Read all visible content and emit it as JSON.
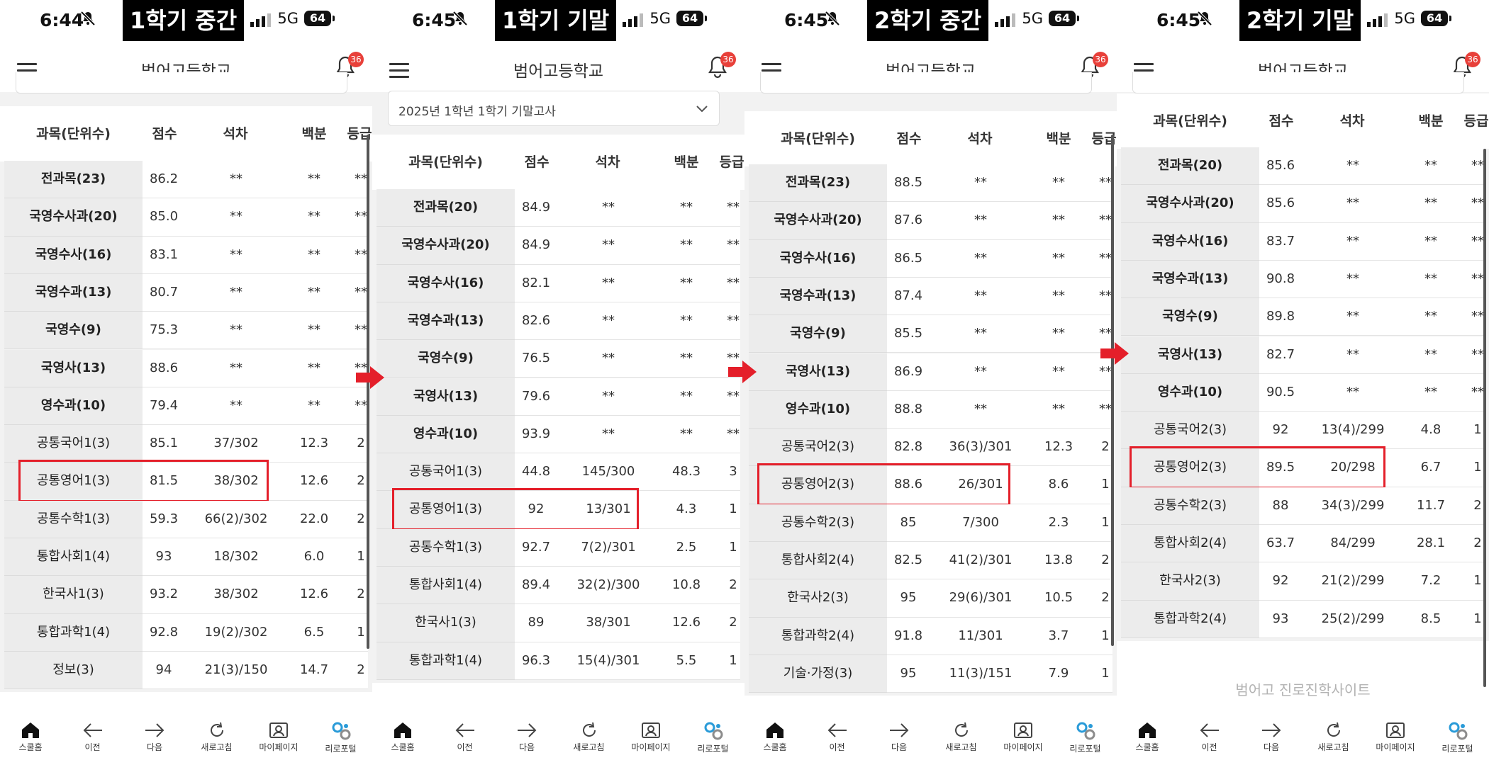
{
  "nav_labels": {
    "home": "스쿨홈",
    "prev": "이전",
    "next": "다음",
    "refresh": "새로고침",
    "mypage": "마이페이지",
    "portal": "리로포털"
  },
  "header_columns": {
    "subject": "과목(단위수)",
    "score": "점수",
    "rank": "석차",
    "percent": "백분",
    "grade": "등급"
  },
  "colors": {
    "highlight": "#e41f2a",
    "badge": "#e8403a",
    "label_bg": "#000000"
  },
  "panels": [
    {
      "time": "6:44",
      "network": "5G",
      "battery": "64",
      "label": "1학기 중간",
      "school": "범어고등학교",
      "badge": "36",
      "dropdown": null,
      "rows": [
        {
          "subject": "전과목(23)",
          "bold": true,
          "score": "86.2",
          "rank": "**",
          "percent": "**",
          "grade": "**"
        },
        {
          "subject": "국영수사과(20)",
          "bold": true,
          "score": "85.0",
          "rank": "**",
          "percent": "**",
          "grade": "**"
        },
        {
          "subject": "국영수사(16)",
          "bold": true,
          "score": "83.1",
          "rank": "**",
          "percent": "**",
          "grade": "**"
        },
        {
          "subject": "국영수과(13)",
          "bold": true,
          "score": "80.7",
          "rank": "**",
          "percent": "**",
          "grade": "**"
        },
        {
          "subject": "국영수(9)",
          "bold": true,
          "score": "75.3",
          "rank": "**",
          "percent": "**",
          "grade": "**"
        },
        {
          "subject": "국영사(13)",
          "bold": true,
          "score": "88.6",
          "rank": "**",
          "percent": "**",
          "grade": "**"
        },
        {
          "subject": "영수과(10)",
          "bold": true,
          "score": "79.4",
          "rank": "**",
          "percent": "**",
          "grade": "**"
        },
        {
          "subject": "공통국어1(3)",
          "bold": false,
          "score": "85.1",
          "rank": "37/302",
          "percent": "12.3",
          "grade": "2"
        },
        {
          "subject": "공통영어1(3)",
          "bold": false,
          "score": "81.5",
          "rank": "38/302",
          "percent": "12.6",
          "grade": "2",
          "highlight": true
        },
        {
          "subject": "공통수학1(3)",
          "bold": false,
          "score": "59.3",
          "rank": "66(2)/302",
          "percent": "22.0",
          "grade": "2"
        },
        {
          "subject": "통합사회1(4)",
          "bold": false,
          "score": "93",
          "rank": "18/302",
          "percent": "6.0",
          "grade": "1"
        },
        {
          "subject": "한국사1(3)",
          "bold": false,
          "score": "93.2",
          "rank": "38/302",
          "percent": "12.6",
          "grade": "2"
        },
        {
          "subject": "통합과학1(4)",
          "bold": false,
          "score": "92.8",
          "rank": "19(2)/302",
          "percent": "6.5",
          "grade": "1"
        },
        {
          "subject": "정보(3)",
          "bold": false,
          "score": "94",
          "rank": "21(3)/150",
          "percent": "14.7",
          "grade": "2"
        }
      ]
    },
    {
      "time": "6:45",
      "network": "5G",
      "battery": "64",
      "label": "1학기 기말",
      "school": "범어고등학교",
      "badge": "36",
      "dropdown": "2025년 1학년 1학기 기말고사",
      "rows": [
        {
          "subject": "전과목(20)",
          "bold": true,
          "score": "84.9",
          "rank": "**",
          "percent": "**",
          "grade": "**"
        },
        {
          "subject": "국영수사과(20)",
          "bold": true,
          "score": "84.9",
          "rank": "**",
          "percent": "**",
          "grade": "**"
        },
        {
          "subject": "국영수사(16)",
          "bold": true,
          "score": "82.1",
          "rank": "**",
          "percent": "**",
          "grade": "**"
        },
        {
          "subject": "국영수과(13)",
          "bold": true,
          "score": "82.6",
          "rank": "**",
          "percent": "**",
          "grade": "**"
        },
        {
          "subject": "국영수(9)",
          "bold": true,
          "score": "76.5",
          "rank": "**",
          "percent": "**",
          "grade": "**"
        },
        {
          "subject": "국영사(13)",
          "bold": true,
          "score": "79.6",
          "rank": "**",
          "percent": "**",
          "grade": "**"
        },
        {
          "subject": "영수과(10)",
          "bold": true,
          "score": "93.9",
          "rank": "**",
          "percent": "**",
          "grade": "**"
        },
        {
          "subject": "공통국어1(3)",
          "bold": false,
          "score": "44.8",
          "rank": "145/300",
          "percent": "48.3",
          "grade": "3"
        },
        {
          "subject": "공통영어1(3)",
          "bold": false,
          "score": "92",
          "rank": "13/301",
          "percent": "4.3",
          "grade": "1",
          "highlight": true
        },
        {
          "subject": "공통수학1(3)",
          "bold": false,
          "score": "92.7",
          "rank": "7(2)/301",
          "percent": "2.5",
          "grade": "1"
        },
        {
          "subject": "통합사회1(4)",
          "bold": false,
          "score": "89.4",
          "rank": "32(2)/300",
          "percent": "10.8",
          "grade": "2"
        },
        {
          "subject": "한국사1(3)",
          "bold": false,
          "score": "89",
          "rank": "38/301",
          "percent": "12.6",
          "grade": "2"
        },
        {
          "subject": "통합과학1(4)",
          "bold": false,
          "score": "96.3",
          "rank": "15(4)/301",
          "percent": "5.5",
          "grade": "1"
        }
      ]
    },
    {
      "time": "6:45",
      "network": "5G",
      "battery": "64",
      "label": "2학기 중간",
      "school": "범어고등학교",
      "badge": "36",
      "dropdown": null,
      "rows": [
        {
          "subject": "전과목(23)",
          "bold": true,
          "score": "88.5",
          "rank": "**",
          "percent": "**",
          "grade": "**"
        },
        {
          "subject": "국영수사과(20)",
          "bold": true,
          "score": "87.6",
          "rank": "**",
          "percent": "**",
          "grade": "**"
        },
        {
          "subject": "국영수사(16)",
          "bold": true,
          "score": "86.5",
          "rank": "**",
          "percent": "**",
          "grade": "**"
        },
        {
          "subject": "국영수과(13)",
          "bold": true,
          "score": "87.4",
          "rank": "**",
          "percent": "**",
          "grade": "**"
        },
        {
          "subject": "국영수(9)",
          "bold": true,
          "score": "85.5",
          "rank": "**",
          "percent": "**",
          "grade": "**"
        },
        {
          "subject": "국영사(13)",
          "bold": true,
          "score": "86.9",
          "rank": "**",
          "percent": "**",
          "grade": "**"
        },
        {
          "subject": "영수과(10)",
          "bold": true,
          "score": "88.8",
          "rank": "**",
          "percent": "**",
          "grade": "**"
        },
        {
          "subject": "공통국어2(3)",
          "bold": false,
          "score": "82.8",
          "rank": "36(3)/301",
          "percent": "12.3",
          "grade": "2"
        },
        {
          "subject": "공통영어2(3)",
          "bold": false,
          "score": "88.6",
          "rank": "26/301",
          "percent": "8.6",
          "grade": "1",
          "highlight": true
        },
        {
          "subject": "공통수학2(3)",
          "bold": false,
          "score": "85",
          "rank": "7/300",
          "percent": "2.3",
          "grade": "1"
        },
        {
          "subject": "통합사회2(4)",
          "bold": false,
          "score": "82.5",
          "rank": "41(2)/301",
          "percent": "13.8",
          "grade": "2"
        },
        {
          "subject": "한국사2(3)",
          "bold": false,
          "score": "95",
          "rank": "29(6)/301",
          "percent": "10.5",
          "grade": "2"
        },
        {
          "subject": "통합과학2(4)",
          "bold": false,
          "score": "91.8",
          "rank": "11/301",
          "percent": "3.7",
          "grade": "1"
        },
        {
          "subject": "기술·가정(3)",
          "bold": false,
          "score": "95",
          "rank": "11(3)/151",
          "percent": "7.9",
          "grade": "1"
        }
      ]
    },
    {
      "time": "6:45",
      "network": "5G",
      "battery": "64",
      "label": "2학기 기말",
      "school": "범어고등학교",
      "badge": "36",
      "dropdown": null,
      "footer_link": "범어고 진로진학사이트",
      "rows": [
        {
          "subject": "전과목(20)",
          "bold": true,
          "score": "85.6",
          "rank": "**",
          "percent": "**",
          "grade": "**"
        },
        {
          "subject": "국영수사과(20)",
          "bold": true,
          "score": "85.6",
          "rank": "**",
          "percent": "**",
          "grade": "**"
        },
        {
          "subject": "국영수사(16)",
          "bold": true,
          "score": "83.7",
          "rank": "**",
          "percent": "**",
          "grade": "**"
        },
        {
          "subject": "국영수과(13)",
          "bold": true,
          "score": "90.8",
          "rank": "**",
          "percent": "**",
          "grade": "**"
        },
        {
          "subject": "국영수(9)",
          "bold": true,
          "score": "89.8",
          "rank": "**",
          "percent": "**",
          "grade": "**"
        },
        {
          "subject": "국영사(13)",
          "bold": true,
          "score": "82.7",
          "rank": "**",
          "percent": "**",
          "grade": "**"
        },
        {
          "subject": "영수과(10)",
          "bold": true,
          "score": "90.5",
          "rank": "**",
          "percent": "**",
          "grade": "**"
        },
        {
          "subject": "공통국어2(3)",
          "bold": false,
          "score": "92",
          "rank": "13(4)/299",
          "percent": "4.8",
          "grade": "1"
        },
        {
          "subject": "공통영어2(3)",
          "bold": false,
          "score": "89.5",
          "rank": "20/298",
          "percent": "6.7",
          "grade": "1",
          "highlight": true
        },
        {
          "subject": "공통수학2(3)",
          "bold": false,
          "score": "88",
          "rank": "34(3)/299",
          "percent": "11.7",
          "grade": "2"
        },
        {
          "subject": "통합사회2(4)",
          "bold": false,
          "score": "63.7",
          "rank": "84/299",
          "percent": "28.1",
          "grade": "2"
        },
        {
          "subject": "한국사2(3)",
          "bold": false,
          "score": "92",
          "rank": "21(2)/299",
          "percent": "7.2",
          "grade": "1"
        },
        {
          "subject": "통합과학2(4)",
          "bold": false,
          "score": "93",
          "rank": "25(2)/299",
          "percent": "8.5",
          "grade": "1"
        }
      ]
    }
  ]
}
